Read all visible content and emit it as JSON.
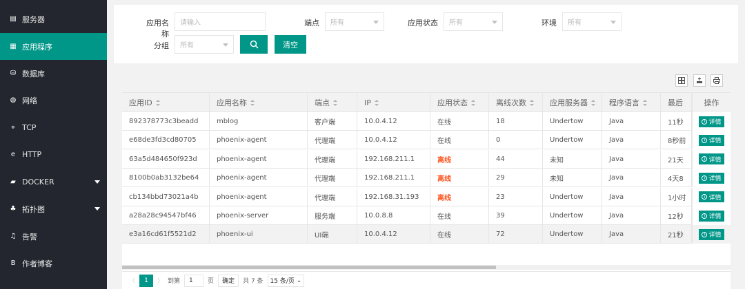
{
  "sidebar": {
    "items": [
      {
        "label": "服务器",
        "icon": "server-icon",
        "glyph": "▤"
      },
      {
        "label": "应用程序",
        "icon": "app-icon",
        "glyph": "▦"
      },
      {
        "label": "数据库",
        "icon": "database-icon",
        "glyph": "⛁"
      },
      {
        "label": "网络",
        "icon": "globe-icon",
        "glyph": "◍"
      },
      {
        "label": "TCP",
        "icon": "tcp-icon",
        "glyph": "⌖"
      },
      {
        "label": "HTTP",
        "icon": "ie-icon",
        "glyph": "e"
      },
      {
        "label": "DOCKER",
        "icon": "docker-icon",
        "glyph": "▰"
      },
      {
        "label": "拓扑图",
        "icon": "topology-icon",
        "glyph": "♣"
      },
      {
        "label": "告警",
        "icon": "bell-icon",
        "glyph": "♫"
      },
      {
        "label": "作者博客",
        "icon": "blog-icon",
        "glyph": "B"
      }
    ],
    "active_index": 1
  },
  "filter": {
    "app_name_label": "应用名称",
    "app_name_placeholder": "请输入",
    "endpoint_label": "端点",
    "endpoint_value": "所有",
    "status_label": "应用状态",
    "status_value": "所有",
    "env_label": "环境",
    "env_value": "所有",
    "group_label": "分组",
    "group_value": "所有",
    "clear_label": "清空"
  },
  "table": {
    "columns": [
      "应用ID",
      "应用名称",
      "端点",
      "IP",
      "应用状态",
      "离线次数",
      "应用服务器",
      "程序语言",
      "最后"
    ],
    "op_header": "操作",
    "detail_label": "详情",
    "rows": [
      {
        "id": "892378773c3beadd",
        "name": "mblog",
        "endpoint": "客户端",
        "ip": "10.0.4.12",
        "status": "在线",
        "offline": "18",
        "server": "Undertow",
        "lang": "Java",
        "last": "11秒",
        "offline_flag": false
      },
      {
        "id": "e68de3fd3cd80705",
        "name": "phoenix-agent",
        "endpoint": "代理端",
        "ip": "10.0.4.12",
        "status": "在线",
        "offline": "0",
        "server": "Undertow",
        "lang": "Java",
        "last": "8秒前",
        "offline_flag": false
      },
      {
        "id": "63a5d484650f923d",
        "name": "phoenix-agent",
        "endpoint": "代理端",
        "ip": "192.168.211.1",
        "status": "离线",
        "offline": "44",
        "server": "未知",
        "lang": "Java",
        "last": "21天",
        "offline_flag": true
      },
      {
        "id": "8100b0ab3132be64",
        "name": "phoenix-agent",
        "endpoint": "代理端",
        "ip": "192.168.211.1",
        "status": "离线",
        "offline": "29",
        "server": "未知",
        "lang": "Java",
        "last": "4天8",
        "offline_flag": true
      },
      {
        "id": "cb134bbd73021a4b",
        "name": "phoenix-agent",
        "endpoint": "代理端",
        "ip": "192.168.31.193",
        "status": "离线",
        "offline": "23",
        "server": "Undertow",
        "lang": "Java",
        "last": "1小时",
        "offline_flag": true
      },
      {
        "id": "a28a28c94547bf46",
        "name": "phoenix-server",
        "endpoint": "服务端",
        "ip": "10.0.8.8",
        "status": "在线",
        "offline": "39",
        "server": "Undertow",
        "lang": "Java",
        "last": "12秒",
        "offline_flag": false
      },
      {
        "id": "e3a16cd61f5521d2",
        "name": "phoenix-ui",
        "endpoint": "UI端",
        "ip": "10.0.4.12",
        "status": "在线",
        "offline": "72",
        "server": "Undertow",
        "lang": "Java",
        "last": "21秒",
        "offline_flag": false
      }
    ],
    "highlighted_row": 6
  },
  "pager": {
    "prev": "〈",
    "current": "1",
    "next": "〉",
    "goto_label": "到第",
    "goto_value": "1",
    "page_unit": "页",
    "confirm_label": "确定",
    "total_label": "共 7 条",
    "page_size": "15 条/页"
  },
  "colors": {
    "accent": "#009688",
    "sidebar_bg": "#23262e",
    "offline": "#ff5722"
  }
}
